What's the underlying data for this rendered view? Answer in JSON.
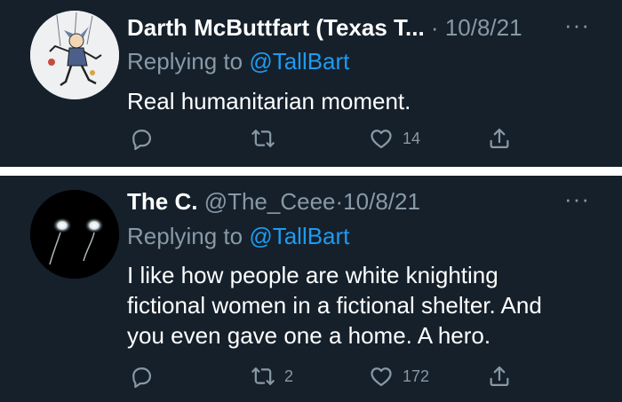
{
  "tweets": [
    {
      "display_name": "Darth McButtfart (Texas T...",
      "handle": "",
      "separator": "·",
      "date": "10/8/21",
      "more_label": "···",
      "replying_prefix": "Replying to",
      "replying_to": "@TallBart",
      "body_lines": [
        "Real humanitarian moment."
      ],
      "retweet_count": "",
      "like_count": "14",
      "avatar_icon": "cartoon-character-avatar"
    },
    {
      "display_name": "The C.",
      "handle": "@The_Ceee",
      "separator": "·",
      "date": "10/8/21",
      "more_label": "···",
      "replying_prefix": "Replying to",
      "replying_to": "@TallBart",
      "body_lines": [
        "I like how people are white knighting",
        "fictional women in a fictional shelter.  And",
        "you even gave one a home.  A hero."
      ],
      "retweet_count": "2",
      "like_count": "172",
      "avatar_icon": "glowing-eyes-avatar"
    }
  ],
  "colors": {
    "background": "#15202b",
    "muted_text": "#8899a6",
    "link": "#1d9bf0",
    "divider": "#ffffff"
  },
  "icons": [
    "reply-icon",
    "retweet-icon",
    "like-icon",
    "share-icon",
    "more-icon"
  ]
}
